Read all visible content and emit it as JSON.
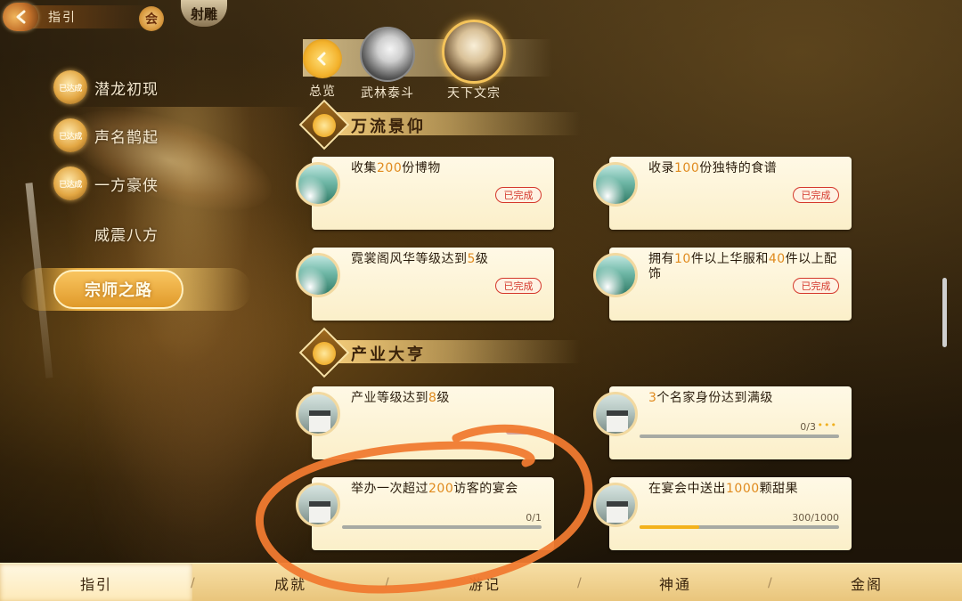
{
  "header": {
    "title": "指引",
    "home_glyph": "会",
    "logo_text": "射雕"
  },
  "sidebar": {
    "items": [
      {
        "badge": "已达成",
        "label": "潜龙初现"
      },
      {
        "badge": "已达成",
        "label": "声名鹊起"
      },
      {
        "badge": "已达成",
        "label": "一方豪侠"
      },
      {
        "badge": "",
        "label": "威震八方"
      },
      {
        "badge": "",
        "label": "宗师之路",
        "active": true
      }
    ]
  },
  "tabs": [
    {
      "label": "总览",
      "icon": "chevron-left-icon"
    },
    {
      "label": "武林泰斗",
      "icon": "portrait-icon"
    },
    {
      "label": "天下文宗",
      "icon": "portrait-icon",
      "selected": true
    }
  ],
  "sections": [
    {
      "title": "万流景仰",
      "cards": [
        {
          "pre": "收集",
          "num": "200",
          "post": "份博物",
          "status": "已完成",
          "icon": "landscape-icon"
        },
        {
          "pre": "收录",
          "num": "100",
          "post": "份独特的食谱",
          "status": "已完成",
          "icon": "landscape-icon"
        },
        {
          "pre": "霓裳阁风华等级达到",
          "num": "5",
          "post": "级",
          "status": "已完成",
          "icon": "landscape-icon"
        },
        {
          "pre": "拥有",
          "num": "10",
          "mid": "件以上华服和",
          "num2": "40",
          "post": "件以上配饰",
          "status": "已完成",
          "icon": "landscape-icon"
        }
      ]
    },
    {
      "title": "产业大亨",
      "cards": [
        {
          "pre": "产业等级达到",
          "num": "8",
          "post": "级",
          "icon": "house-icon"
        },
        {
          "pre": "",
          "num": "3",
          "post": "个名家身份达到满级",
          "progress_text": "0/3",
          "progress": 0,
          "dots": "•••",
          "icon": "house-icon"
        },
        {
          "pre": "举办一次超过",
          "num": "200",
          "post": "访客的宴会",
          "progress_text": "0/1",
          "progress": 0,
          "icon": "house-icon"
        },
        {
          "pre": "在宴会中送出",
          "num": "1000",
          "post": "颗甜果",
          "progress_text": "300/1000",
          "progress": 0.3,
          "icon": "house-icon"
        }
      ]
    }
  ],
  "bottom_nav": [
    {
      "label": "指引",
      "active": true
    },
    {
      "label": "成就"
    },
    {
      "label": "游记"
    },
    {
      "label": "神通"
    },
    {
      "label": "金阁"
    }
  ],
  "colors": {
    "accent": "#f3b21c",
    "highlight_number": "#e08a1e",
    "done_stamp": "#d4372b",
    "annotation": "#f07a30"
  }
}
